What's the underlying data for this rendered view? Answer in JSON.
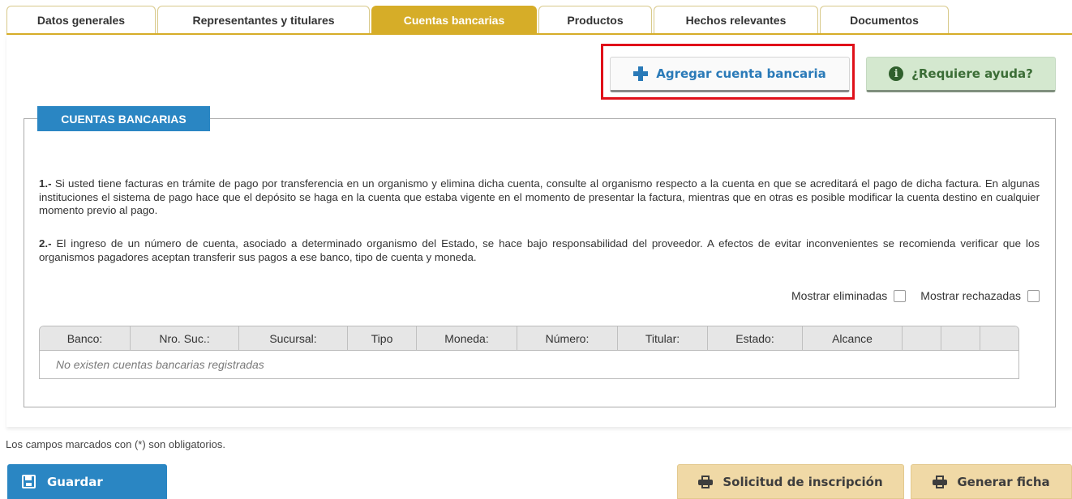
{
  "tabs": [
    {
      "label": "Datos generales",
      "active": false
    },
    {
      "label": "Representantes y titulares",
      "active": false
    },
    {
      "label": "Cuentas bancarias",
      "active": true
    },
    {
      "label": "Productos",
      "active": false
    },
    {
      "label": "Hechos relevantes",
      "active": false
    },
    {
      "label": "Documentos",
      "active": false
    }
  ],
  "toolbar": {
    "add_label": "Agregar cuenta bancaria",
    "help_label": "¿Requiere ayuda?"
  },
  "section": {
    "legend": "CUENTAS BANCARIAS",
    "para1_num": "1.-",
    "para1_text": "Si usted tiene facturas en trámite de pago por transferencia en un organismo y elimina dicha cuenta, consulte al organismo respecto a la cuenta en que se acreditará el pago de dicha factura. En algunas instituciones el sistema de pago hace que el depósito se haga en la cuenta que estaba vigente en el momento de presentar la factura, mientras que en otras es posible modificar la cuenta destino en cualquier momento previo al pago.",
    "para2_num": "2.-",
    "para2_text": "El ingreso de un número de cuenta, asociado a determinado organismo del Estado, se hace bajo responsabilidad del proveedor. A efectos de evitar inconvenientes se recomienda verificar que los organismos pagadores aceptan transferir sus pagos a ese banco, tipo de cuenta y moneda."
  },
  "filters": {
    "show_deleted": "Mostrar eliminadas",
    "show_rejected": "Mostrar rechazadas"
  },
  "table": {
    "columns": [
      "Banco:",
      "Nro. Suc.:",
      "Sucursal:",
      "Tipo",
      "Moneda:",
      "Número:",
      "Titular:",
      "Estado:",
      "Alcance",
      "",
      "",
      ""
    ],
    "empty_message": "No existen cuentas bancarias registradas"
  },
  "footnote": "Los campos marcados con (*) son obligatorios.",
  "footer": {
    "save_label": "Guardar",
    "request_label": "Solicitud de inscripción",
    "generate_label": "Generar ficha"
  },
  "colors": {
    "accent_gold": "#d6ad28",
    "primary_blue": "#2a86c3",
    "help_green": "#d4e8cf",
    "highlight_red": "#e0101a"
  }
}
